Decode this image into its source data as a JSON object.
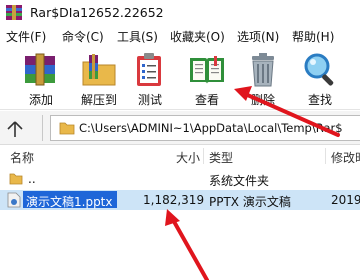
{
  "window": {
    "title": "Rar$DIa12652.22652"
  },
  "menu": {
    "items": [
      "文件(F)",
      "命令(C)",
      "工具(S)",
      "收藏夹(O)",
      "选项(N)",
      "帮助(H)"
    ]
  },
  "toolbar": {
    "buttons": [
      {
        "label": "添加",
        "icon": "add-archive-icon"
      },
      {
        "label": "解压到",
        "icon": "extract-folder-icon"
      },
      {
        "label": "测试",
        "icon": "test-clipboard-icon"
      },
      {
        "label": "查看",
        "icon": "view-book-icon"
      },
      {
        "label": "删除",
        "icon": "trash-icon"
      },
      {
        "label": "查找",
        "icon": "find-magnifier-icon"
      }
    ]
  },
  "address": {
    "path": "C:\\Users\\ADMINI~1\\AppData\\Local\\Temp\\Rar$"
  },
  "columns": {
    "name": "名称",
    "size": "大小",
    "type": "类型",
    "modified": "修改时"
  },
  "files": [
    {
      "name": "..",
      "size": "",
      "type": "系统文件夹",
      "modified": ""
    },
    {
      "name": "演示文稿1.pptx",
      "size": "1,182,319",
      "type": "PPTX 演示文稿",
      "modified": "2019"
    }
  ],
  "colors": {
    "accent": "#1e66d8",
    "selection": "#cde4f7",
    "annotation_arrow": "#e0151d"
  }
}
